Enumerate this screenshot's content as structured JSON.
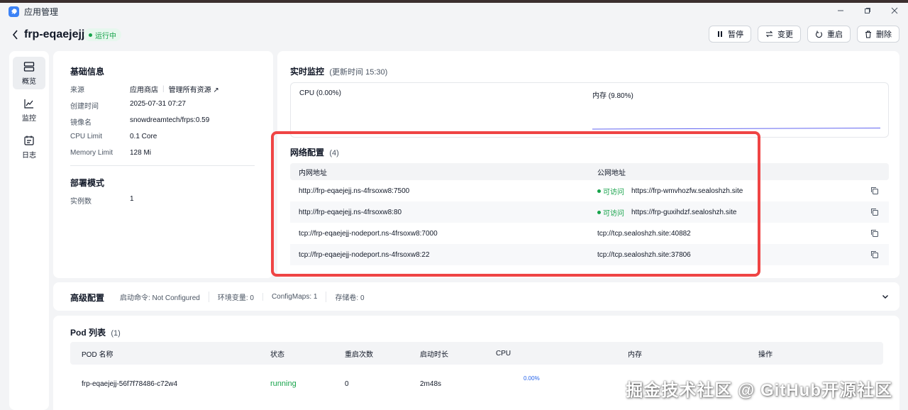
{
  "window": {
    "title": "应用管理",
    "controls": [
      "minimize-icon",
      "restore-icon",
      "close-icon"
    ]
  },
  "header": {
    "app_name": "frp-eqaejejj",
    "status": "运行中",
    "actions": [
      {
        "label": "暂停",
        "icon": "pause-icon"
      },
      {
        "label": "变更",
        "icon": "swap-icon"
      },
      {
        "label": "重启",
        "icon": "restart-icon"
      },
      {
        "label": "删除",
        "icon": "trash-icon"
      }
    ]
  },
  "sidebar": {
    "items": [
      {
        "label": "概览",
        "icon": "overview-icon",
        "active": true
      },
      {
        "label": "监控",
        "icon": "chart-icon",
        "active": false
      },
      {
        "label": "日志",
        "icon": "log-icon",
        "active": false
      }
    ]
  },
  "basic_info": {
    "title": "基础信息",
    "rows": [
      {
        "label": "来源",
        "value": "应用商店",
        "link": "管理所有资源"
      },
      {
        "label": "创建时间",
        "value": "2025-07-31 07:27"
      },
      {
        "label": "镜像名",
        "value": "snowdreamtech/frps:0.59"
      },
      {
        "label": "CPU Limit",
        "value": "0.1 Core"
      },
      {
        "label": "Memory Limit",
        "value": "128 Mi"
      }
    ]
  },
  "deploy_mode": {
    "title": "部署模式",
    "rows": [
      {
        "label": "实例数",
        "value": "1"
      }
    ]
  },
  "monitor": {
    "title": "实时监控",
    "updated": "(更新时间  15:30)",
    "cpu_label": "CPU  (0.00%)",
    "mem_label": "内存  (9.80%)",
    "line_color": "#6366f1"
  },
  "network": {
    "title": "网络配置",
    "count": "(4)",
    "col_internal": "内网地址",
    "col_public": "公网地址",
    "access_label": "可访问",
    "rows": [
      {
        "internal": "http://frp-eqaejejj.ns-4frsoxw8:7500",
        "public": "https://frp-wmvhozfw.sealoshzh.site",
        "accessible": true
      },
      {
        "internal": "http://frp-eqaejejj.ns-4frsoxw8:80",
        "public": "https://frp-guxihdzf.sealoshzh.site",
        "accessible": true
      },
      {
        "internal": "tcp://frp-eqaejejj-nodeport.ns-4frsoxw8:7000",
        "public": "tcp://tcp.sealoshzh.site:40882",
        "accessible": false
      },
      {
        "internal": "tcp://frp-eqaejejj-nodeport.ns-4frsoxw8:22",
        "public": "tcp://tcp.sealoshzh.site:37806",
        "accessible": false
      }
    ],
    "highlight_color": "#ef4444"
  },
  "advanced": {
    "title": "高级配置",
    "tags": [
      "启动命令: Not Configured",
      "环境变量: 0",
      "ConfigMaps: 1",
      "存储卷: 0"
    ]
  },
  "pods": {
    "title": "Pod 列表",
    "count": "(1)",
    "columns": [
      "POD 名称",
      "状态",
      "重启次数",
      "启动时长",
      "CPU",
      "内存",
      "操作"
    ],
    "rows": [
      {
        "name": "frp-eqaejejj-56f7f78486-c72w4",
        "status": "running",
        "restarts": "0",
        "uptime": "2m48s",
        "cpu": "0.00%"
      }
    ]
  },
  "watermark": "掘金技术社区 @ GitHub开源社区"
}
